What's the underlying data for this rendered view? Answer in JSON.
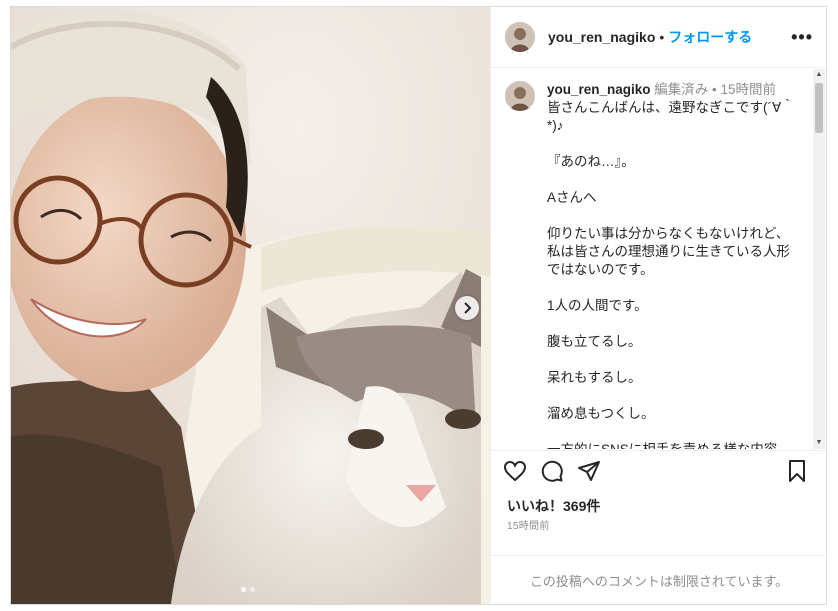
{
  "post": {
    "username": "you_ren_nagiko",
    "follow_label": "フォローする",
    "separator": "•",
    "more_label": "•••"
  },
  "caption": {
    "username": "you_ren_nagiko",
    "meta": "編集済み • 15時間前",
    "lines": [
      "皆さんこんばんは、遠野なぎこです(´∀｀*)♪",
      "",
      "『あのね…』。",
      "",
      "Aさんへ",
      "",
      "仰りたい事は分からなくもないけれど、私は皆さんの理想通りに生きている人形ではないのです。",
      "",
      "1人の人間です。",
      "",
      "腹も立てるし。",
      "",
      "呆れもするし。",
      "",
      "溜め息もつくし。",
      "",
      "一方的にSNSに相手を責める様な内容"
    ]
  },
  "stats": {
    "likes": "いいね！369件",
    "time_ago": "15時間前"
  },
  "comments": {
    "restricted_text": "この投稿へのコメントは制限されています。"
  },
  "icons": {
    "like": "heart-icon",
    "comment": "comment-icon",
    "share": "share-icon",
    "save": "bookmark-icon",
    "next": "chevron-right-icon"
  },
  "colors": {
    "follow": "#0095f6",
    "muted": "#8e8e8e",
    "border": "#dbdbdb"
  }
}
